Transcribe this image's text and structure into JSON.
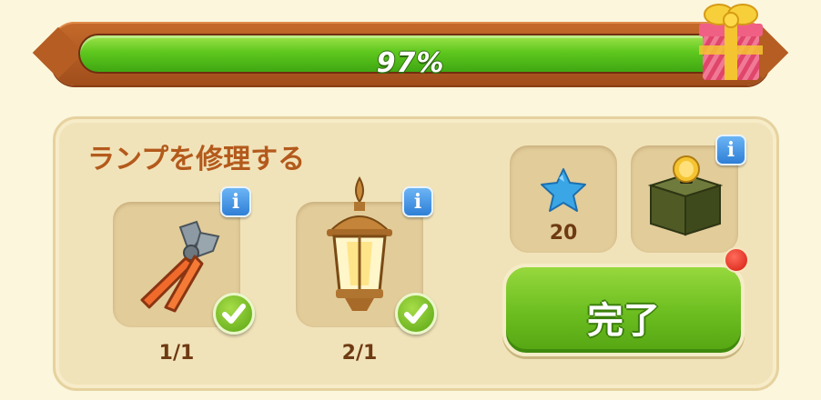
{
  "progress": {
    "percent_label": "97%",
    "fraction": 0.97
  },
  "task": {
    "title": "ランプを修理する"
  },
  "requirements": [
    {
      "name": "pliers",
      "count": "1/1",
      "info": "i"
    },
    {
      "name": "lantern",
      "count": "2/1",
      "info": "i"
    }
  ],
  "rewards": [
    {
      "name": "blue-star",
      "count": "20"
    },
    {
      "name": "coin-box",
      "info": "i"
    }
  ],
  "complete_button": {
    "label": "完了"
  },
  "colors": {
    "accent_green": "#6bbd1f",
    "title_brown": "#b35a1c",
    "info_blue": "#2f7fd6"
  }
}
